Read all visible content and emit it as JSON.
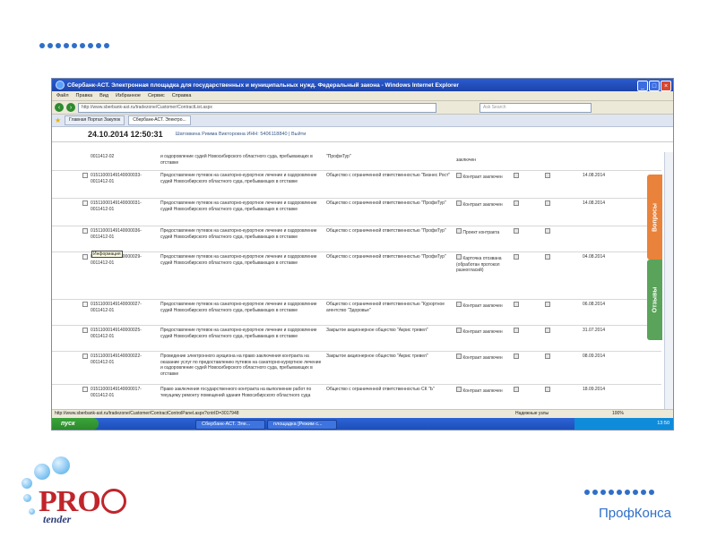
{
  "colors": {
    "accent": "#2f6fc9",
    "logo_red": "#c0252b"
  },
  "window": {
    "title": "Сбербанк-АСТ. Электронная площадка для государственных и муниципальных нужд. Федеральный закона - Windows Internet Explorer",
    "controls": [
      "_",
      "□",
      "×"
    ]
  },
  "menu": [
    "Файл",
    "Правка",
    "Вид",
    "Избранное",
    "Сервис",
    "Справка"
  ],
  "address": {
    "url": "http://www.sberbank-ast.ru/tradezone/Customer/ContractList.aspx",
    "search_placeholder": "Ask Search"
  },
  "tabs": [
    "Главная Портал Закупок",
    "Сбербанк-АСТ. Электро..."
  ],
  "header": {
    "datetime": "24.10.2014 12:50:31",
    "user": "Шатовкина Римма Викторовна ИНН: 5406118840 | Выйти"
  },
  "rows": [
    {
      "num": "",
      "id": "0011412-02",
      "subject": "и оздоровление судей Новосибирского областного суда, пребывающих в отставке",
      "supplier": "\"ПрофиТур\"",
      "status": "заключен",
      "date": ""
    },
    {
      "num": "",
      "id": "01511000149140000033-0011412-01",
      "subject": "Предоставление путевок на санаторно-курортное лечение и оздоровление судей Новосибирского областного суда, пребывающих в отставке",
      "supplier": "Общество с ограниченной ответственностью \"Бизнес Рост\"",
      "status": "Контракт заключен",
      "date": "14.08.2014"
    },
    {
      "num": "",
      "id": "01511000149140000031-0011412-01",
      "subject": "Предоставление путевок на санаторно-курортное лечение и оздоровление судей Новосибирского областного суда, пребывающих в отставке",
      "supplier": "Общество с ограниченной ответственностью \"ПрофиТур\"",
      "status": "Контракт заключен",
      "date": "14.08.2014"
    },
    {
      "num": "",
      "id": "01511000149140000036-0011412-01",
      "subject": "Предоставление путевок на санаторно-курортное лечение и оздоровление судей Новосибирского областного суда, пребывающих в отставке",
      "supplier": "Общество с ограниченной ответственностью \"ПрофиТур\"",
      "status": "Проект контракта",
      "date": ""
    },
    {
      "num": "",
      "id": "01511000149140000029-0011412-01",
      "subject": "Предоставление путевок на санаторно-курортное лечение и оздоровление судей Новосибирского областного суда, пребывающих в отставке",
      "supplier": "Общество с ограниченной ответственностью \"ПрофиТур\"",
      "status": "Карточка отозвана (обработан протокол разногласий)",
      "date": "04.08.2014"
    },
    {
      "num": "",
      "id": "01511000149140000027-0011412-01",
      "subject": "Предоставление путевок на санаторно-курортное лечение и оздоровление судей Новосибирского областного суда, пребывающих в отставке",
      "supplier": "Общество с ограниченной ответственностью \"Курортное агентство \"Здоровье\"",
      "status": "Контракт заключен",
      "date": "06.08.2014"
    },
    {
      "num": "",
      "id": "01511000149140000025-0011412-01",
      "subject": "Предоставление путевок на санаторно-курортное лечение и оздоровление судей Новосибирского областного суда, пребывающих в отставке",
      "supplier": "Закрытое акционерное общество \"Акрис тревел\"",
      "status": "Контракт заключен",
      "date": "31.07.2014"
    },
    {
      "num": "",
      "id": "01511000149140000022-0011412-01",
      "subject": "Проведение электронного аукциона на право заключения контракта на оказание услуг по предоставлению путевок на санаторно-курортное лечение и оздоровление судей Новосибирского областного суда, пребывающих в отставке",
      "supplier": "Закрытое акционерное общество \"Акрис тревел\"",
      "status": "Контракт заключен",
      "date": "08.09.2014"
    },
    {
      "num": "",
      "id": "01511000149140000017-0011412-01",
      "subject": "Право заключения государственного контракта на выполнение работ по текущему ремонту помещений здания Новосибирского областного суда",
      "supplier": "Общество с ограниченной ответственностью СК \"Ь\"",
      "status": "Контракт заключен",
      "date": "18.09.2014"
    }
  ],
  "tooltip": "Информация",
  "side_tabs": {
    "questions": "Вопросы",
    "reviews": "Отзывы"
  },
  "status": {
    "url": "http://www.sberbank-ast.ru/tradezone/Customer/ContractControlPanel.aspx?cntrID=3017948",
    "zone": "Надежные узлы",
    "zoom": "100%"
  },
  "taskbar": {
    "start": "пуск",
    "items": [
      "Сбербанк-АСТ. Эле...",
      "площадка [Режим с..."
    ],
    "tray": "13:50"
  },
  "logo": {
    "pro": "PRO",
    "tender": "tender"
  },
  "brand": "ПрофКонса"
}
